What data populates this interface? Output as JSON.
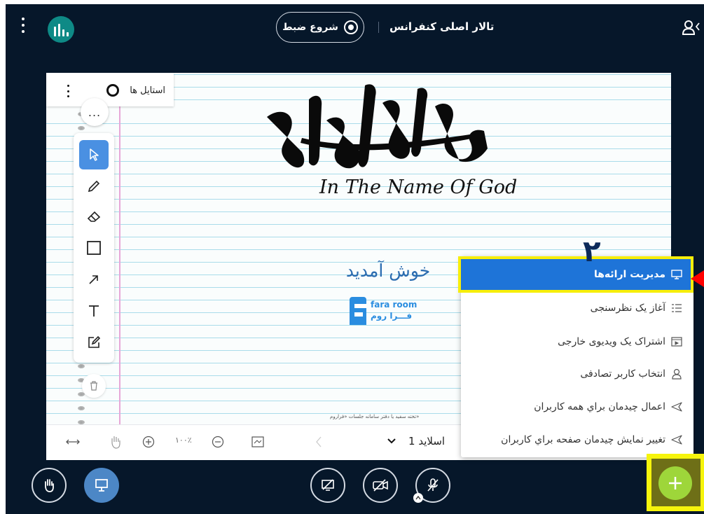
{
  "header": {
    "conference_title": "تالار اصلی کنفرانس",
    "record_label": "شروع ضبط"
  },
  "whiteboard": {
    "styles_label": "استایل ها",
    "more_glyph": "...",
    "calligraphy_alt": "بسم الله الرحمن الرحيم",
    "name_of_god": "In The Name Of God",
    "welcome": "خوش آمدید",
    "brand_en": "fara room",
    "brand_fa": "فـــرا روم",
    "footnote": "تخته سفید یا دفتر سامانه جلسات «فراروم»"
  },
  "presentation_bar": {
    "zoom": "۱۰۰٪",
    "slide_label": "اسلاید 1"
  },
  "menu": {
    "items": [
      {
        "label": "مدیریت ارائه‌ها",
        "icon": "presentation-icon"
      },
      {
        "label": "آغاز یک نظرسنجی",
        "icon": "poll-icon"
      },
      {
        "label": "اشتراک یک ویدیوی خارجی",
        "icon": "external-video-icon"
      },
      {
        "label": "انتخاب کاربر تصادفی",
        "icon": "user-icon"
      },
      {
        "label": "اعمال چیدمان براي همه کاربران",
        "icon": "send-icon"
      },
      {
        "label": "تغییر نمایش چیدمان صفحه براي کاربران",
        "icon": "send-icon"
      }
    ]
  },
  "annotation": {
    "step_number": "۲"
  },
  "colors": {
    "background": "#06172a",
    "highlight": "#1e74d8",
    "annotation_yellow": "#f7ee0a",
    "plus_button": "#9ed63a",
    "logo": "#0e8a86"
  }
}
